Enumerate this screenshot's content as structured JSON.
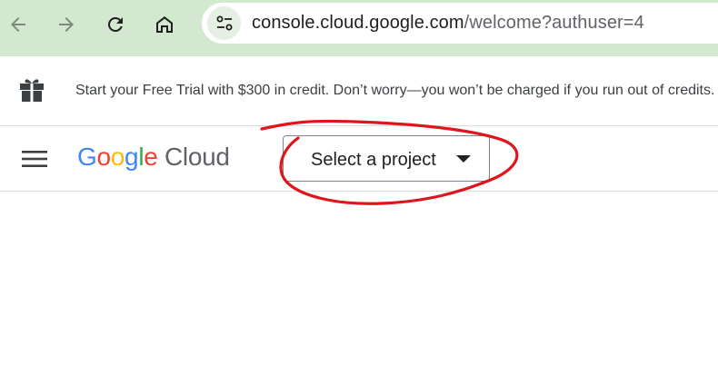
{
  "browser": {
    "url_host": "console.cloud.google.com",
    "url_path": "/welcome?authuser=4",
    "icons": [
      "back-arrow-icon",
      "forward-arrow-icon",
      "reload-icon",
      "home-icon",
      "site-settings-icon"
    ]
  },
  "banner": {
    "icon": "gift-icon",
    "text": "Start your Free Trial with $300 in credit. Don’t worry—you won’t be charged if you run out of credits."
  },
  "header": {
    "menu_icon": "hamburger-menu-icon",
    "logo": {
      "letters": [
        "G",
        "o",
        "o",
        "g",
        "l",
        "e"
      ],
      "product": "Cloud"
    },
    "project_picker": {
      "label": "Select a project"
    }
  },
  "colors": {
    "browser_bar": "#d3e9cf",
    "google_blue": "#4285f4",
    "google_red": "#ea4335",
    "google_yellow": "#fbbc05",
    "google_green": "#34a853",
    "annotation_red": "#e0141b"
  }
}
